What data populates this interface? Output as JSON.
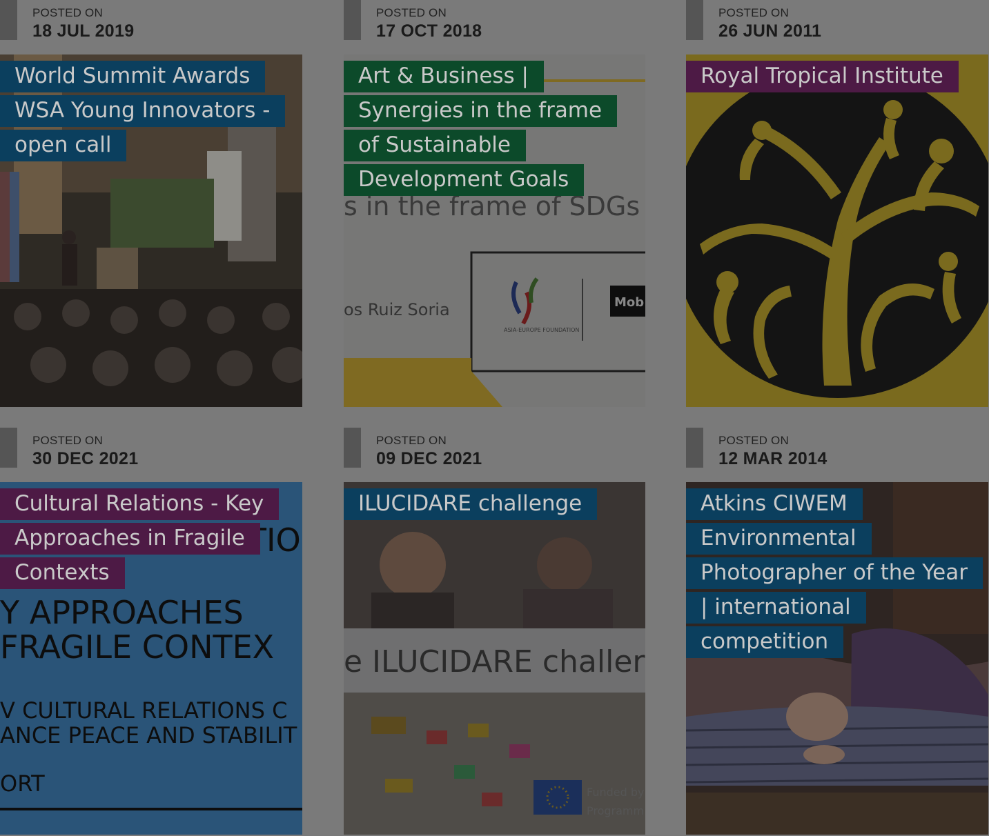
{
  "posts": [
    {
      "posted_label": "POSTED ON",
      "date": "18 JUL 2019",
      "title": "World Summit Awards WSA Young Innovators - open call",
      "tag_color": "#0b3f5e",
      "image": "conference-hall-photo"
    },
    {
      "posted_label": "POSTED ON",
      "date": "17 OCT 2018",
      "title": "Art & Business | Synergies in the frame of Sustainable Development Goals",
      "tag_color": "#0c4a2a",
      "image": "art-business-banner",
      "image_text": {
        "line1": "s in the frame of SDGs",
        "line2": "os Ruiz Soria",
        "logo_caption": "ASIA-EUROPE FOUNDATION",
        "logo_right": "Mob"
      }
    },
    {
      "posted_label": "POSTED ON",
      "date": "26 JUN 2011",
      "title": "Royal Tropical Institute",
      "tag_color": "#4d1a45",
      "image": "royal-tropical-logo"
    },
    {
      "posted_label": "POSTED ON",
      "date": "30 DEC 2021",
      "title": "Cultural Relations - Key Approaches in Fragile Contexts",
      "tag_color": "#4d1a45",
      "image": "cultural-relations-report-cover",
      "image_text": {
        "l1": "ATIO",
        "l2": "Y APPROACHES",
        "l3": "FRAGILE CONTEX",
        "l4": "V CULTURAL RELATIONS C",
        "l5": "ANCE PEACE AND STABILIT",
        "l6": "ORT"
      }
    },
    {
      "posted_label": "POSTED ON",
      "date": "09 DEC 2021",
      "title": "ILUCIDARE challenge",
      "tag_color": "#0b3f5e",
      "image": "ilucidare-banner",
      "image_text": {
        "banner": "e ILUCIDARE challer",
        "funded1": "Funded by",
        "funded2": "Programm"
      }
    },
    {
      "posted_label": "POSTED ON",
      "date": "12 MAR 2014",
      "title": "Atkins CIWEM Environmental Photographer of the Year | international competition",
      "tag_color": "#0b3f5e",
      "image": "sleeping-child-photo"
    }
  ]
}
